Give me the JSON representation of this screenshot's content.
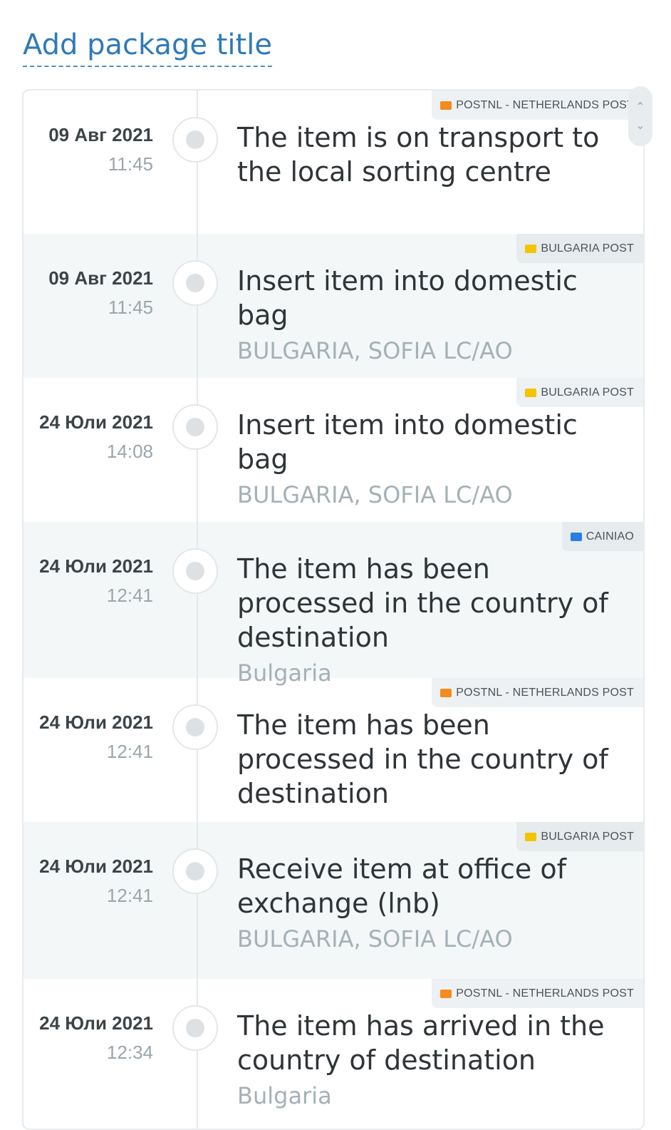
{
  "header": {
    "add_title_label": "Add package title"
  },
  "carriers": {
    "postnl": {
      "name": "POSTNL - NETHERLANDS POST",
      "logo_color": "#f28c1e"
    },
    "bgpost": {
      "name": "BULGARIA POST",
      "logo_color": "#f5c400"
    },
    "cainiao": {
      "name": "CAINIAO",
      "logo_color": "#2a7de1"
    }
  },
  "events": [
    {
      "carrier": "POSTNL - NETHERLANDS POST",
      "date": "09 Авг 2021",
      "time": "11:45",
      "status": "The item is on transport to the local sorting centre",
      "location": ""
    },
    {
      "carrier": "BULGARIA POST",
      "date": "09 Авг 2021",
      "time": "11:45",
      "status": "Insert item into domestic bag",
      "location": "BULGARIA, SOFIA LC/AO"
    },
    {
      "carrier": "BULGARIA POST",
      "date": "24 Юли 2021",
      "time": "14:08",
      "status": "Insert item into domestic bag",
      "location": "BULGARIA, SOFIA LC/AO"
    },
    {
      "carrier": "CAINIAO",
      "date": "24 Юли 2021",
      "time": "12:41",
      "status": "The item has been processed in the country of destination",
      "location": "Bulgaria"
    },
    {
      "carrier": "POSTNL - NETHERLANDS POST",
      "date": "24 Юли 2021",
      "time": "12:41",
      "status": "The item has been processed in the country of destination",
      "location": ""
    },
    {
      "carrier": "BULGARIA POST",
      "date": "24 Юли 2021",
      "time": "12:41",
      "status": "Receive item at office of exchange (lnb)",
      "location": "BULGARIA, SOFIA LC/AO"
    },
    {
      "carrier": "POSTNL - NETHERLANDS POST",
      "date": "24 Юли 2021",
      "time": "12:34",
      "status": "The item has arrived in the country of destination",
      "location": "Bulgaria"
    }
  ],
  "scroll_controls": {
    "up_icon": "chevron-up-icon",
    "down_icon": "chevron-down-icon"
  }
}
